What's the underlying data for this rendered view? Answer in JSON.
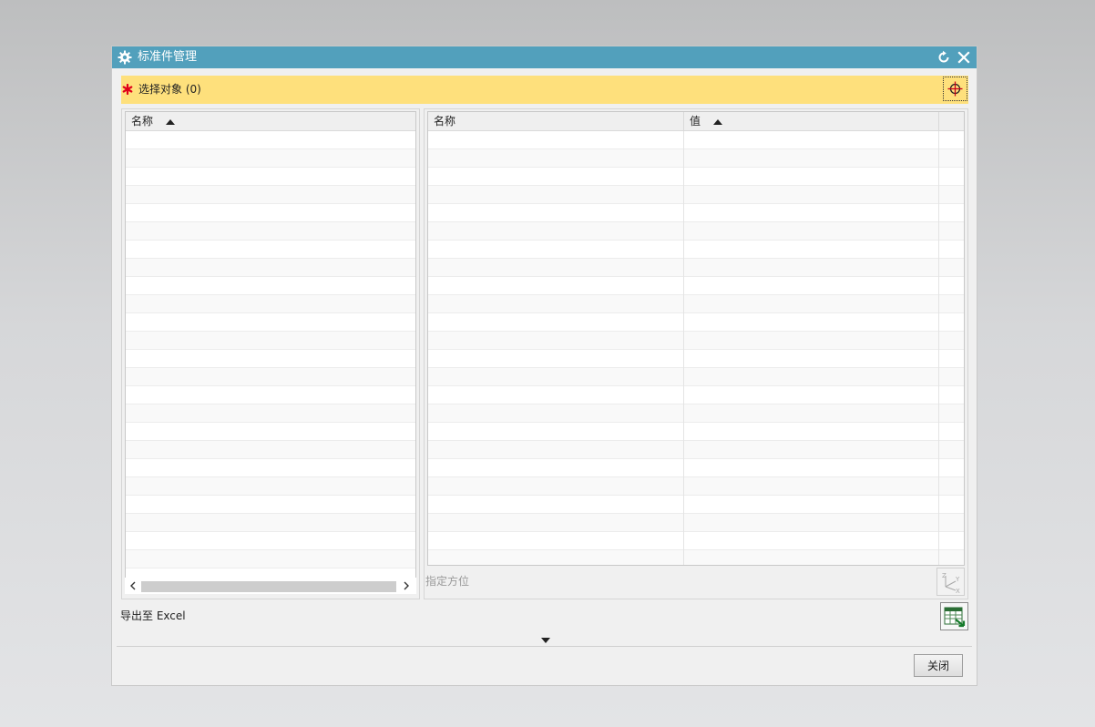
{
  "dialog": {
    "title": "标准件管理",
    "icons": {
      "title": "gear-icon",
      "reset": "reset-icon",
      "close": "close-icon"
    }
  },
  "selection": {
    "required_icon": "required-star-icon",
    "label": "选择对象 (0)",
    "picker_icon": "crosshair-icon",
    "required_color": "#e0001a",
    "highlight_color": "#fee07c"
  },
  "left_table": {
    "columns": [
      {
        "label": "名称",
        "sort": "ascending"
      }
    ],
    "rows": []
  },
  "right_table": {
    "columns": [
      {
        "label": "名称"
      },
      {
        "label": "值",
        "sort": "ascending"
      }
    ],
    "rows": []
  },
  "orientation": {
    "label": "指定方位",
    "icon": "csys-orientation-icon",
    "axis_labels": {
      "z": "Z",
      "y": "Y",
      "x": "X"
    }
  },
  "export": {
    "label": "导出至 Excel",
    "icon": "excel-export-icon"
  },
  "footer": {
    "close_label": "关闭"
  },
  "theme": {
    "titlebar_color": "#52a0bc"
  }
}
